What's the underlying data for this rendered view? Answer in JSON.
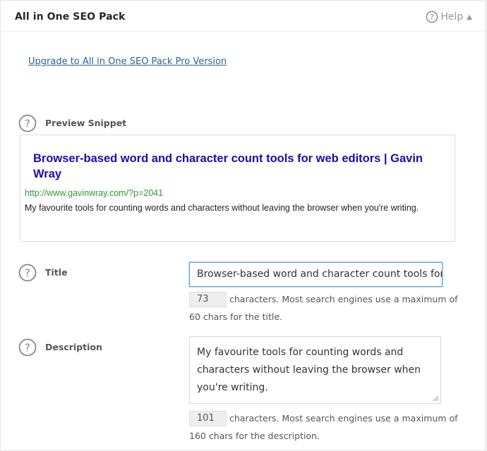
{
  "panel": {
    "title": "All in One SEO Pack",
    "help_label": "Help",
    "collapse_glyph": "▲"
  },
  "upgrade_link": "Upgrade to All in One SEO Pack Pro Version",
  "preview": {
    "label": "Preview Snippet",
    "title": "Browser-based word and character count tools for web editors | Gavin Wray",
    "url": "http://www.gavinwray.com/?p=2041",
    "description": "My favourite tools for counting words and characters without leaving the browser when you're writing."
  },
  "title_field": {
    "label": "Title",
    "value": "Browser-based word and character count tools for web editors | Gavin Wray",
    "count": "73",
    "hint_line1": "characters. Most search engines use a maximum of",
    "hint_line2": "60 chars for the title."
  },
  "description_field": {
    "label": "Description",
    "value": "My favourite tools for counting words and characters without leaving the browser when you're writing.",
    "count": "101",
    "hint_line1": "characters. Most search engines use a maximum of",
    "hint_line2": "160 chars for the description."
  },
  "colors": {
    "link": "#2a6496",
    "snippet_title": "#1a0dab",
    "snippet_url": "#339933",
    "focus_border": "#5b9dd9"
  },
  "icons": [
    "help-circle-icon",
    "question-circle-icon",
    "collapse-arrow-icon",
    "resize-handle-icon"
  ]
}
